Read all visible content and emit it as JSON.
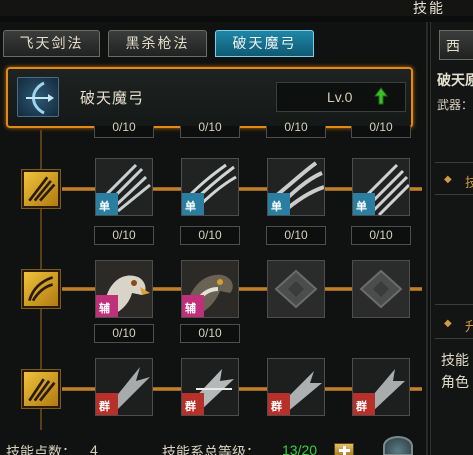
{
  "window": {
    "title": "技能"
  },
  "tabs": [
    {
      "label": "飞天剑法",
      "active": false
    },
    {
      "label": "黑杀枪法",
      "active": false
    },
    {
      "label": "破天魔弓",
      "active": true
    }
  ],
  "selected_skill": {
    "name": "破天魔弓",
    "level": "Lv.0",
    "upgrade_icon": "green-up-arrow-icon"
  },
  "rows": [
    {
      "top_counts": [
        "0/10",
        "0/10",
        "0/10",
        "0/10"
      ],
      "type_icon": "slash-claw-icon",
      "slots": [
        {
          "art": "white-claw-strike",
          "badge": "单",
          "badge_color": "#2a7fa0"
        },
        {
          "art": "white-claw-strike",
          "badge": "单",
          "badge_color": "#2a7fa0"
        },
        {
          "art": "white-claw-strike",
          "badge": "单",
          "badge_color": "#2a7fa0"
        },
        {
          "art": "white-claw-strike",
          "badge": "单",
          "badge_color": "#2a7fa0"
        }
      ],
      "counts": [
        "0/10",
        "0/10",
        "0/10",
        "0/10"
      ]
    },
    {
      "type_icon": "feather-wing-icon",
      "slots": [
        {
          "art": "eagle-head",
          "badge": "辅",
          "badge_color": "#c0307a"
        },
        {
          "art": "falcon-head",
          "badge": "辅",
          "badge_color": "#c0307a"
        },
        {
          "art": "stone-rune-locked",
          "badge": "",
          "badge_color": ""
        },
        {
          "art": "stone-rune-locked",
          "badge": "",
          "badge_color": ""
        }
      ],
      "counts": [
        "0/10",
        "0/10"
      ]
    },
    {
      "type_icon": "triple-slash-icon",
      "slots": [
        {
          "art": "silver-blade-burst",
          "badge": "群",
          "badge_color": "#b8302a"
        },
        {
          "art": "silver-blade-burst",
          "badge": "群",
          "badge_color": "#b8302a"
        },
        {
          "art": "silver-blade-burst",
          "badge": "群",
          "badge_color": "#b8302a"
        },
        {
          "art": "silver-blade-burst",
          "badge": "群",
          "badge_color": "#b8302a"
        }
      ]
    }
  ],
  "footer": {
    "points_label": "技能点数：",
    "points_value": "4",
    "total_level_label": "技能系总等级：",
    "total_level_value": "13/20"
  },
  "right_panel": {
    "tab_label": "西",
    "skill_name": "破天原",
    "weapon_label": "武器：",
    "section1": "技",
    "section2": "升",
    "text1": "技能",
    "text2": "角色"
  },
  "colors": {
    "accent_orange": "#e38a14",
    "active_tab": "#1f86a8",
    "green": "#35d13b"
  }
}
